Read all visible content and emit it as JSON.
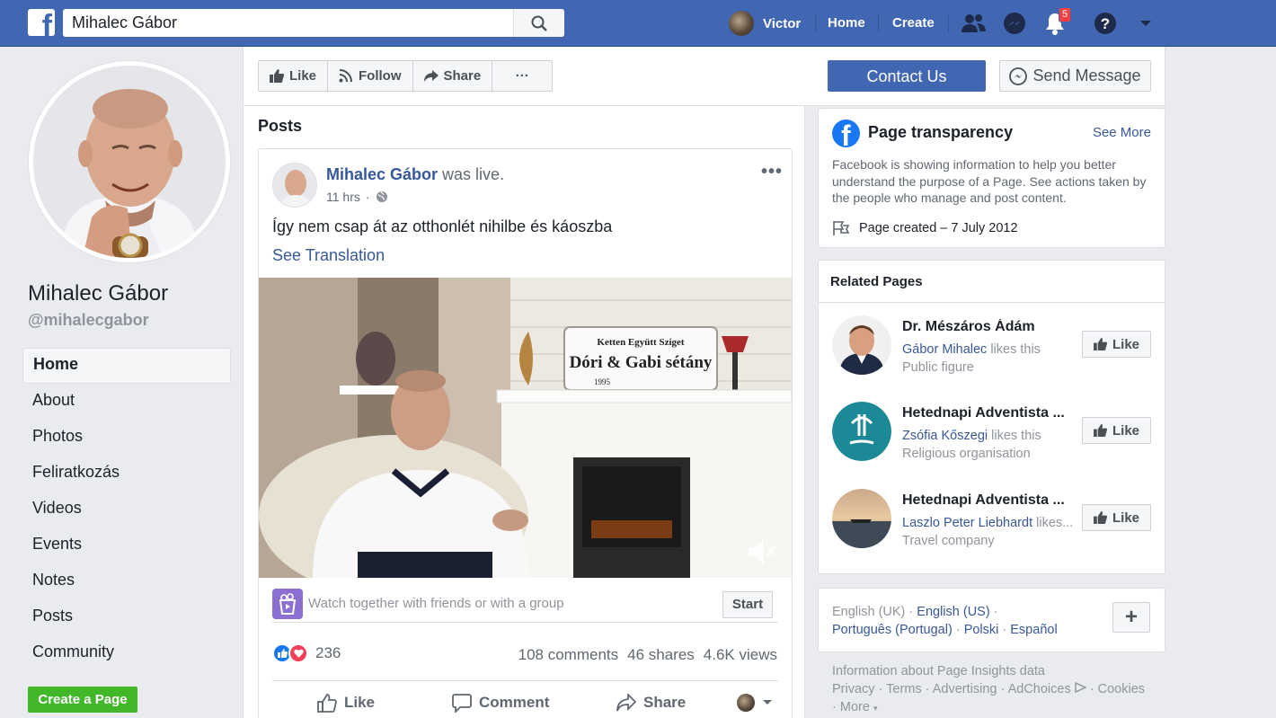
{
  "topbar": {
    "search_value": "Mihalec Gábor",
    "user_name": "Victor",
    "home": "Home",
    "create": "Create",
    "notification_count": "5",
    "brand_color": "#4267b2"
  },
  "page": {
    "name": "Mihalec Gábor",
    "handle": "@mihalecgabor"
  },
  "sidebar": {
    "items": [
      {
        "label": "Home"
      },
      {
        "label": "About"
      },
      {
        "label": "Photos"
      },
      {
        "label": "Feliratkozás"
      },
      {
        "label": "Videos"
      },
      {
        "label": "Events"
      },
      {
        "label": "Notes"
      },
      {
        "label": "Posts"
      },
      {
        "label": "Community"
      }
    ],
    "create_page": "Create a Page"
  },
  "actions": {
    "like": "Like",
    "follow": "Follow",
    "share": "Share",
    "more": "···",
    "contact": "Contact Us",
    "message": "Send Message"
  },
  "posts": {
    "title": "Posts",
    "post": {
      "author": "Mihalec Gábor",
      "activity": "was live.",
      "time": "11 hrs",
      "text": "Így nem csap át az otthonlét nihilbe és káoszba",
      "see_translation": "See Translation",
      "video_sign_top": "Ketten Együtt Sziget",
      "video_sign_main": "Dóri & Gabi sétány",
      "video_sign_year": "1995",
      "watch_text": "Watch together with friends or with a group",
      "start": "Start",
      "reaction_count": "236",
      "comments": "108 comments",
      "shares": "46 shares",
      "views": "4.6K views",
      "like": "Like",
      "comment": "Comment",
      "share": "Share"
    }
  },
  "transparency": {
    "title": "Page transparency",
    "see_more": "See More",
    "description": "Facebook is showing information to help you better understand the purpose of a Page. See actions taken by the people who manage and post content.",
    "created": "Page created – 7 July 2012"
  },
  "related": {
    "title": "Related Pages",
    "pages": [
      {
        "name": "Dr. Mészáros Ádám",
        "friend": "Gábor Mihalec",
        "likes_suffix": " likes this",
        "category": "Public figure",
        "like": "Like"
      },
      {
        "name": "Hetednapi Adventista ...",
        "friend": "Zsófia Kőszegi",
        "likes_suffix": " likes this",
        "category": "Religious organisation",
        "like": "Like"
      },
      {
        "name": "Hetednapi Adventista ...",
        "friend": "Laszlo Peter Liebhardt",
        "likes_suffix": " likes...",
        "category": "Travel company",
        "like": "Like"
      }
    ]
  },
  "languages": {
    "current": "English (UK)",
    "links": [
      "English (US)",
      "Português (Portugal)",
      "Polski",
      "Español"
    ],
    "more": "+"
  },
  "footer": {
    "line1": "Information about Page Insights data",
    "links": [
      "Privacy",
      "Terms",
      "Advertising",
      "AdChoices",
      "Cookies"
    ],
    "more": "More"
  }
}
